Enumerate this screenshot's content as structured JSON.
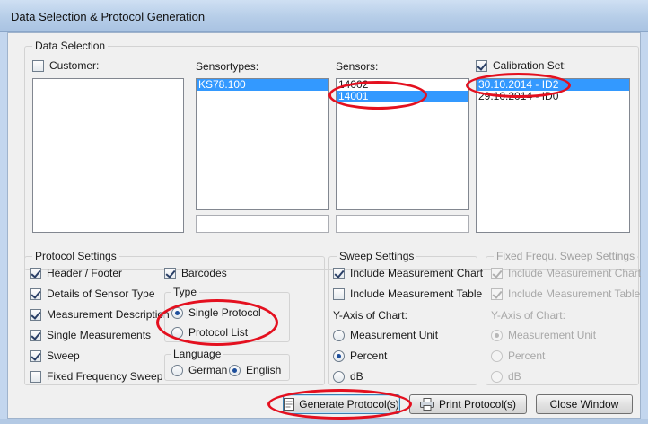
{
  "window": {
    "title": "Data Selection & Protocol Generation"
  },
  "data_selection": {
    "label": "Data Selection",
    "customer": {
      "label": "Customer:",
      "checked": false,
      "items": []
    },
    "sensortypes": {
      "label": "Sensortypes:",
      "items": [
        "KS78.100"
      ],
      "selected": "KS78.100"
    },
    "sensors": {
      "label": "Sensors:",
      "items": [
        "14002",
        "14001"
      ],
      "selected": "14001"
    },
    "calibration_set": {
      "label": "Calibration Set:",
      "checked": true,
      "items": [
        "30.10.2014 - ID2",
        "29.10.2014 - ID0"
      ],
      "selected": "30.10.2014 - ID2"
    }
  },
  "protocol_settings": {
    "label": "Protocol Settings",
    "header_footer": "Header / Footer",
    "details_sensor_type": "Details of Sensor Type",
    "measurement_description": "Measurement Description",
    "single_measurements": "Single Measurements",
    "sweep": "Sweep",
    "fixed_frequency_sweep": "Fixed Frequency Sweep",
    "barcodes": "Barcodes",
    "type": {
      "label": "Type",
      "single_protocol": "Single Protocol",
      "protocol_list": "Protocol List",
      "selected": "Single Protocol"
    },
    "language": {
      "label": "Language",
      "german": "German",
      "english": "English",
      "selected": "English"
    }
  },
  "sweep_settings": {
    "label": "Sweep Settings",
    "include_chart": "Include Measurement Chart",
    "include_table": "Include Measurement Table",
    "y_axis_label": "Y-Axis of Chart:",
    "measurement_unit": "Measurement Unit",
    "percent": "Percent",
    "db": "dB",
    "selected": "Percent"
  },
  "fixed_sweep_settings": {
    "label": "Fixed Frequ. Sweep Settings",
    "include_chart": "Include Measurement Chart",
    "include_table": "Include Measurement Table",
    "y_axis_label": "Y-Axis of Chart:",
    "measurement_unit": "Measurement Unit",
    "percent": "Percent",
    "db": "dB",
    "selected": "Measurement Unit",
    "enabled": false
  },
  "buttons": {
    "generate": "Generate Protocol(s)",
    "print": "Print Protocol(s)",
    "close": "Close Window"
  },
  "colors": {
    "selection": "#3399ff",
    "annotation": "#e4101f"
  }
}
